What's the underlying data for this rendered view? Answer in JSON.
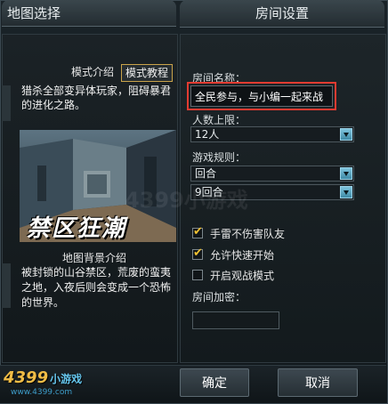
{
  "left_panel": {
    "title": "地图选择",
    "tabs": [
      {
        "label": "模式介绍",
        "active": false
      },
      {
        "label": "模式教程",
        "active": true
      }
    ],
    "mode_description": "猎杀全部变异体玩家，阻碍暴君的进化之路。",
    "map_name": "禁区狂潮",
    "background_title": "地图背景介绍",
    "background_text": "被封锁的山谷禁区，荒废的蛮夷之地，入夜后则会变成一个恐怖的世界。"
  },
  "right_panel": {
    "title": "房间设置",
    "room_name_label": "房间名称：",
    "room_name_value": "全民参与，与小编一起来战",
    "max_players_label": "人数上限：",
    "max_players_value": "12人",
    "rules_label": "游戏规则：",
    "rule_type_value": "回合",
    "rounds_value": "9回合",
    "options": [
      {
        "label": "手雷不伤害队友",
        "checked": true
      },
      {
        "label": "允许快速开始",
        "checked": true
      },
      {
        "label": "开启观战模式",
        "checked": false
      }
    ],
    "password_label": "房间加密：",
    "password_value": ""
  },
  "footer": {
    "confirm_label": "确定",
    "cancel_label": "取消"
  },
  "branding": {
    "logo_text": "4399",
    "logo_sub": "小游戏",
    "logo_url": "www.4399.com",
    "watermark": "4399小游戏"
  },
  "colors": {
    "highlight_outline": "#e23b31",
    "check_color": "#f1c232",
    "accent_blue": "#66c7ef"
  }
}
